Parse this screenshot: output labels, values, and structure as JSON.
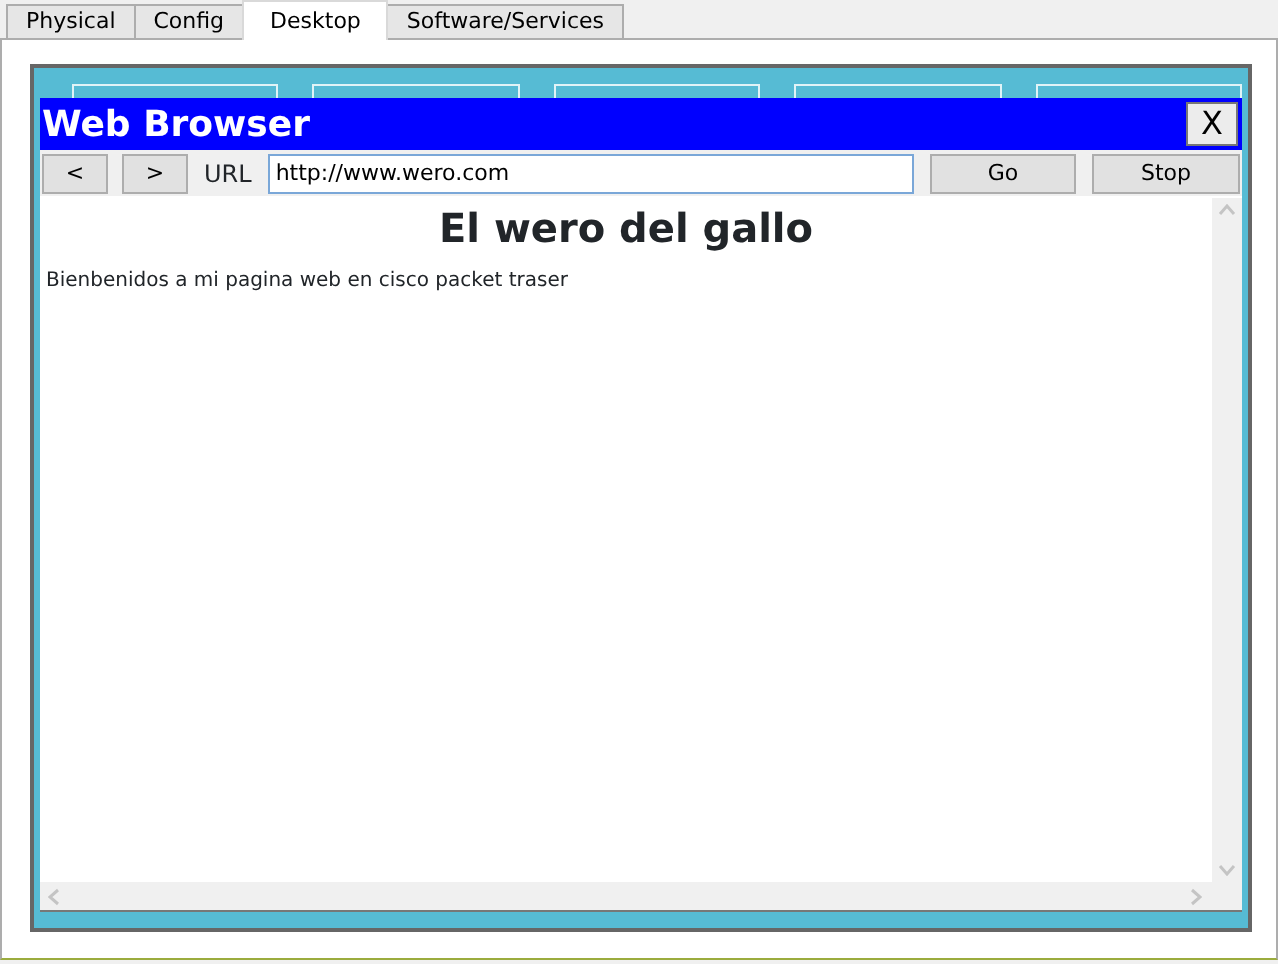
{
  "tabs": [
    {
      "label": "Physical",
      "selected": false
    },
    {
      "label": "Config",
      "selected": false
    },
    {
      "label": "Desktop",
      "selected": true
    },
    {
      "label": "Software/Services",
      "selected": false
    }
  ],
  "desktop": {
    "icons": [
      {
        "kind": "icon"
      },
      {
        "kind": "icon"
      },
      {
        "kind": "icon"
      },
      {
        "kind": "icon"
      },
      {
        "kind": "icon"
      }
    ]
  },
  "browser": {
    "title": "Web Browser",
    "close": "X",
    "back": "<",
    "forward": ">",
    "url_label": "URL",
    "url": "http://www.wero.com",
    "go": "Go",
    "stop": "Stop",
    "page": {
      "heading": "El wero del gallo",
      "text": "Bienbenidos a mi pagina web en cisco packet traser"
    }
  }
}
